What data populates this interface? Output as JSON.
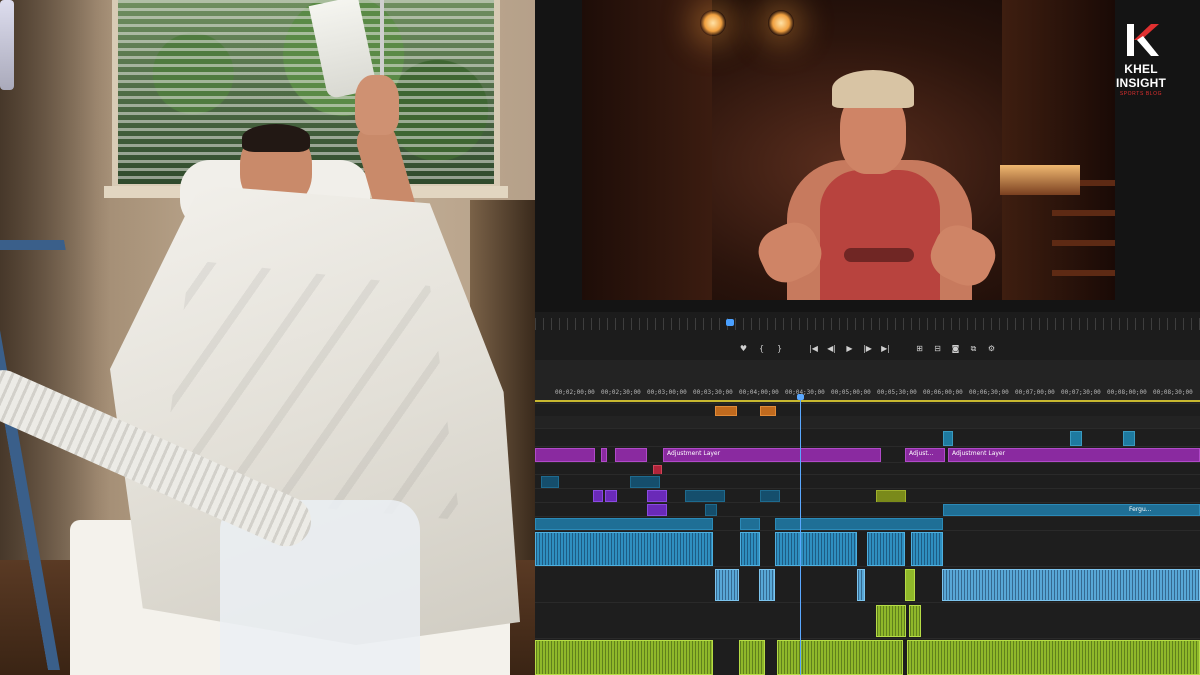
{
  "window": {
    "left_panel": "hospital-photo",
    "right_panel": "video-editor"
  },
  "watermark": {
    "brand_title": "KHEL INSIGHT",
    "brand_subtitle": "SPORTS BLOG",
    "brand_color": "#e03030"
  },
  "transport": {
    "buttons": [
      {
        "name": "marker-icon",
        "glyph": "♥"
      },
      {
        "name": "mark-in-icon",
        "glyph": "{"
      },
      {
        "name": "mark-out-icon",
        "glyph": "}"
      },
      {
        "name": "go-to-in-icon",
        "glyph": "|◀"
      },
      {
        "name": "step-back-icon",
        "glyph": "◀|"
      },
      {
        "name": "play-icon",
        "glyph": "▶"
      },
      {
        "name": "step-forward-icon",
        "glyph": "|▶"
      },
      {
        "name": "go-to-out-icon",
        "glyph": "▶|"
      },
      {
        "name": "lift-icon",
        "glyph": "⊞"
      },
      {
        "name": "extract-icon",
        "glyph": "⊟"
      },
      {
        "name": "export-frame-icon",
        "glyph": "◙"
      },
      {
        "name": "comparison-view-icon",
        "glyph": "⧉"
      },
      {
        "name": "settings-icon",
        "glyph": "⚙"
      }
    ]
  },
  "timeline": {
    "timecodes": [
      "00;02;00;00",
      "00;02;30;00",
      "00;03;00;00",
      "00;03;30;00",
      "00;04;00;00",
      "00;04;30;00",
      "00;05;00;00",
      "00;05;30;00",
      "00;06;00;00",
      "00;06;30;00",
      "00;07;00;00",
      "00;07;30;00",
      "00;08;00;00",
      "00;08;30;00"
    ],
    "clip_labels": {
      "adjustment_1": "Adjustment Layer",
      "adjustment_2": "Adjust...",
      "adjustment_3": "Adjustment Layer",
      "ferguson": "Fergu..."
    },
    "colors": {
      "adjustment": "#8a2aa0",
      "video": "#1f6f96",
      "audio": "#58a7d6",
      "music": "#8fb82a",
      "playhead": "#5aa8ff"
    }
  }
}
